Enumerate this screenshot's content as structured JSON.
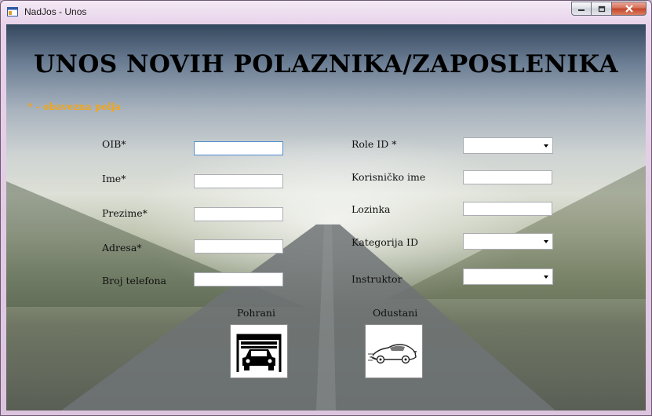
{
  "window": {
    "title": "NadJos - Unos"
  },
  "header": {
    "title": "UNOS NOVIH POLAZNIKA/ZAPOSLENIKA",
    "required_note": "* - obavezna polja"
  },
  "form": {
    "left": [
      {
        "label": "OIB*",
        "value": ""
      },
      {
        "label": "Ime*",
        "value": ""
      },
      {
        "label": "Prezime*",
        "value": ""
      },
      {
        "label": "Adresa*",
        "value": ""
      },
      {
        "label": "Broj telefona",
        "value": ""
      }
    ],
    "right": {
      "role": {
        "label": "Role ID *",
        "selected": ""
      },
      "username": {
        "label": "Korisničko ime",
        "value": ""
      },
      "password": {
        "label": "Lozinka",
        "value": ""
      },
      "category": {
        "label": "Kategorija ID",
        "selected": ""
      },
      "instructor": {
        "label": "Instruktor",
        "selected": ""
      }
    }
  },
  "actions": {
    "save_label": "Pohrani",
    "cancel_label": "Odustani"
  },
  "icons": {
    "save": "garage-car-icon",
    "cancel": "sports-car-sketch-icon"
  }
}
